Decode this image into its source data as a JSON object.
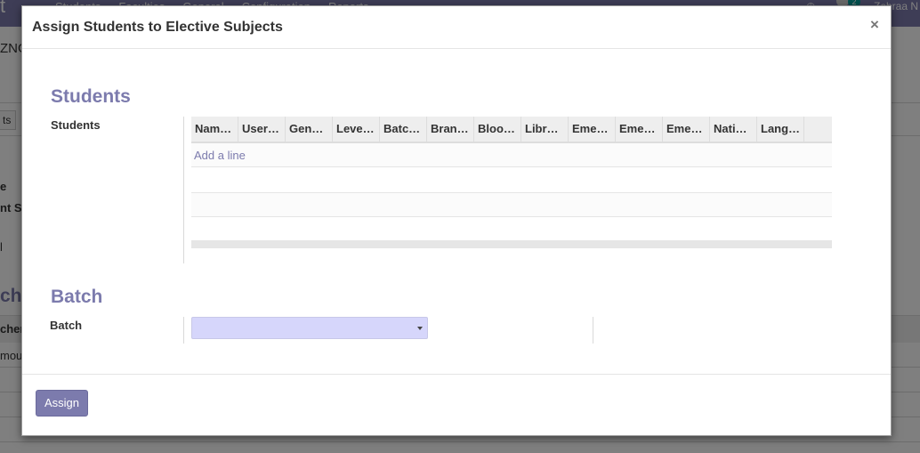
{
  "background": {
    "brand": "t",
    "menu": [
      "Students",
      "Faculties",
      "General",
      "Configuration",
      "Reports"
    ],
    "user": "Zehraa N",
    "chat_badge": "2",
    "fragments": [
      "ZNG",
      "ts",
      "e",
      "nt Su",
      "l",
      "ch",
      "cher",
      "mou"
    ]
  },
  "modal": {
    "title": "Assign Students to Elective Subjects",
    "close_glyph": "×",
    "students_section": {
      "title": "Students",
      "label": "Students",
      "columns": [
        "Nam…",
        "User…",
        "Gen…",
        "Leve…",
        "Batc…",
        "Bran…",
        "Bloo…",
        "Libr…",
        "Eme…",
        "Eme…",
        "Eme…",
        "Nati…",
        "Lang…"
      ],
      "add_line": "Add a line"
    },
    "batch_section": {
      "title": "Batch",
      "label": "Batch",
      "selected": ""
    },
    "footer": {
      "assign_label": "Assign"
    }
  },
  "colors": {
    "accent": "#7c7bad",
    "select_bg": "#d6d6fb"
  }
}
